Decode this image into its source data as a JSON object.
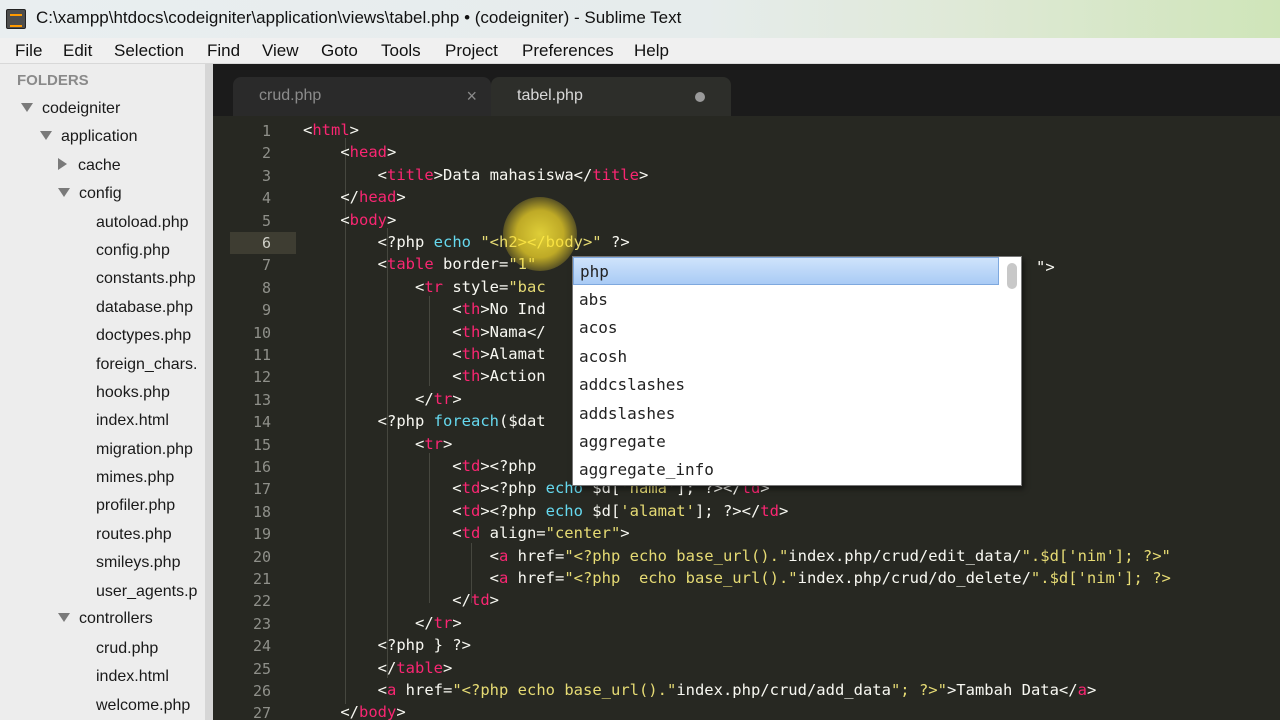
{
  "window": {
    "title": "C:\\xampp\\htdocs\\codeigniter\\application\\views\\tabel.php • (codeigniter) - Sublime Text"
  },
  "menu": [
    "File",
    "Edit",
    "Selection",
    "Find",
    "View",
    "Goto",
    "Tools",
    "Project",
    "Preferences",
    "Help"
  ],
  "sidebar": {
    "header": "FOLDERS",
    "items": [
      "codeigniter",
      "application",
      "cache",
      "config",
      "autoload.php",
      "config.php",
      "constants.php",
      "database.php",
      "doctypes.php",
      "foreign_chars.",
      "hooks.php",
      "index.html",
      "migration.php",
      "mimes.php",
      "profiler.php",
      "routes.php",
      "smileys.php",
      "user_agents.p",
      "controllers",
      "crud.php",
      "index.html",
      "welcome.php"
    ]
  },
  "tabs": [
    {
      "label": "crud.php",
      "close": "×"
    },
    {
      "label": "tabel.php"
    }
  ],
  "editor": {
    "line_numbers": [
      "1",
      "2",
      "3",
      "4",
      "5",
      "6",
      "7",
      "8",
      "9",
      "10",
      "11",
      "12",
      "13",
      "14",
      "15",
      "16",
      "17",
      "18",
      "19",
      "20",
      "21",
      "22",
      "23",
      "24",
      "25",
      "26",
      "27"
    ],
    "lines": [
      "<html>",
      "    <head>",
      "        <title>Data mahasiswa</title>",
      "    </head>",
      "    <body>",
      "        <?php echo \"<h2></body>\" ?>",
      "        <table border=\"1\" ",
      "            <tr style=\"bac",
      "                <th>No Ind",
      "                <th>Nama</",
      "                <th>Alamat",
      "                <th>Action",
      "            </tr>",
      "        <?php foreach($dat",
      "            <tr>",
      "                <td><?php ",
      "                <td><?php echo $d['nama']; ?></td>",
      "                <td><?php echo $d['alamat']; ?></td>",
      "                <td align=\"center\">",
      "                    <a href=\"<?php echo base_url().\"index.php/crud/edit_data/\".$d['nim']; ?>\"",
      "                    <a href=\"<?php  echo base_url().\"index.php/crud/do_delete/\".$d['nim']; ?>",
      "                </td>",
      "            </tr>",
      "        <?php } ?>",
      "        </table>",
      "        <a href=\"<?php echo base_url().\"index.php/crud/add_data\"; ?>\">Tambah Data</a>",
      "    </body>"
    ],
    "line7_tail": "\">"
  },
  "autocomplete": [
    "php",
    "abs",
    "acos",
    "acosh",
    "addcslashes",
    "addslashes",
    "aggregate",
    "aggregate_info"
  ],
  "colors": {
    "tag": "#f92672",
    "string": "#e6db74",
    "keyword": "#66d9ef",
    "bg": "#272822"
  }
}
